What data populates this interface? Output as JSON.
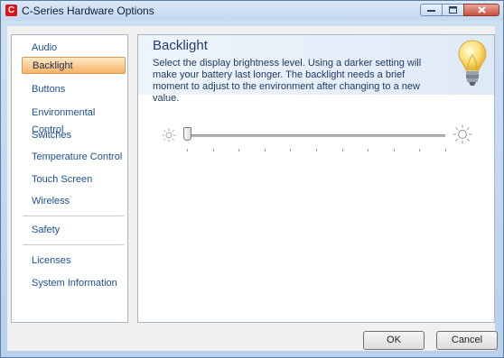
{
  "window": {
    "title": "C-Series Hardware Options",
    "icon_letter": "C",
    "accent_color": "#d9151b"
  },
  "sidebar": {
    "items": [
      {
        "label": "Audio",
        "selected": false
      },
      {
        "label": "Backlight",
        "selected": true
      },
      {
        "label": "Buttons",
        "selected": false
      },
      {
        "label": "Environmental Control",
        "selected": false
      },
      {
        "label": "Switches",
        "selected": false
      },
      {
        "label": "Temperature Control",
        "selected": false
      },
      {
        "label": "Touch Screen",
        "selected": false
      },
      {
        "label": "Wireless",
        "selected": false
      },
      {
        "label": "Safety",
        "selected": false
      },
      {
        "label": "Licenses",
        "selected": false
      },
      {
        "label": "System Information",
        "selected": false
      }
    ]
  },
  "content": {
    "title": "Backlight",
    "description": "Select the display brightness level. Using a darker setting will make your battery last longer. The backlight needs a brief moment to adjust to the environment after changing to a new value.",
    "icon": "lightbulb-icon",
    "slider": {
      "level": 0,
      "min_icon": "dim-sun-icon",
      "max_icon": "bright-sun-icon",
      "tick_count": 11
    }
  },
  "buttons": {
    "ok_label": "OK",
    "cancel_label": "Cancel"
  }
}
